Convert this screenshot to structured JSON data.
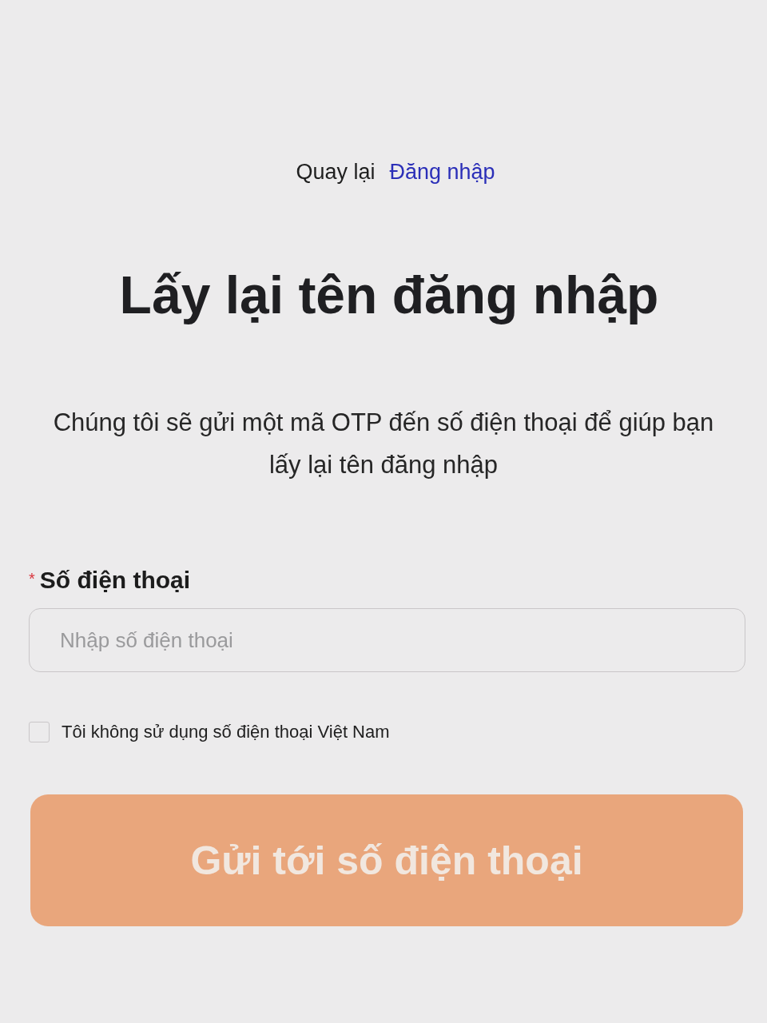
{
  "back_link": {
    "prefix": "Quay lại",
    "link": "Đăng nhập"
  },
  "title": "Lấy lại tên đăng nhập",
  "description": "Chúng tôi sẽ gửi một mã OTP đến số điện thoại để giúp bạn lấy lại tên đăng nhập",
  "phone_field": {
    "required_mark": "*",
    "label": "Số điện thoại",
    "placeholder": "Nhập số điện thoại"
  },
  "foreign_number": {
    "label": "Tôi không sử dụng số điện thoại Việt Nam",
    "checked": false
  },
  "submit_button": {
    "label": "Gửi tới số điện thoại",
    "disabled": true
  }
}
